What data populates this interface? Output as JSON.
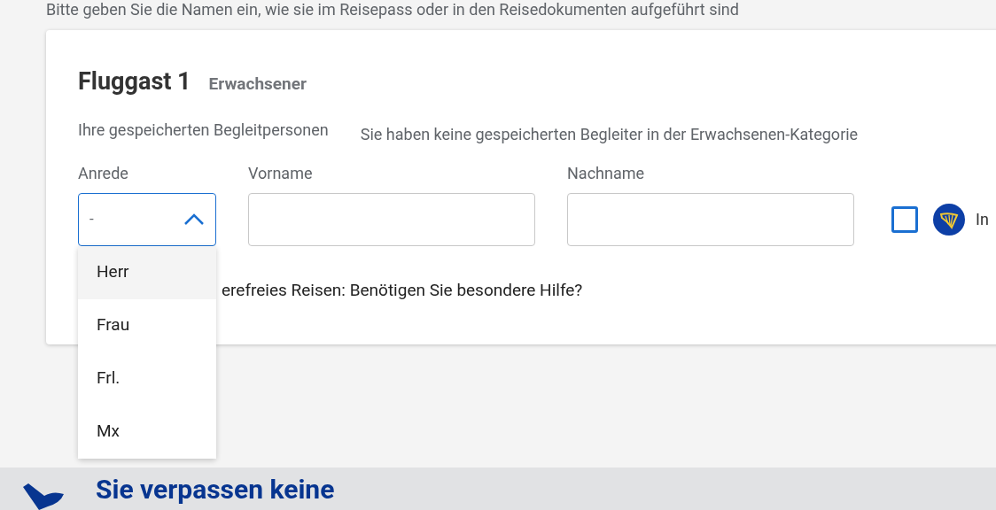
{
  "intro": "Bitte geben Sie die Namen ein, wie sie im Reisepass oder in den Reisedokumenten aufgeführt sind",
  "passenger": {
    "title": "Fluggast 1",
    "category": "Erwachsener"
  },
  "companions": {
    "label": "Ihre gespeicherten Begleitpersonen",
    "message": "Sie haben keine gespeicherten Begleiter in der Erwachsenen-Kategorie"
  },
  "fields": [
    {
      "label": "Anrede",
      "value": "-",
      "expanded": true
    },
    {
      "label": "Vorname"
    },
    {
      "label": "Nachname"
    }
  ],
  "membership": {
    "checked": false,
    "label": "In"
  },
  "dropdown": [
    {
      "label": "Herr",
      "selected": true
    },
    {
      "label": "Frau",
      "selected": false
    },
    {
      "label": "Frl.",
      "selected": false
    },
    {
      "label": "Mx",
      "selected": false
    }
  ],
  "assistance": "erefreies Reisen: Benötigen Sie besondere Hilfe?",
  "banner": {
    "title": "Sie verpassen keine"
  }
}
